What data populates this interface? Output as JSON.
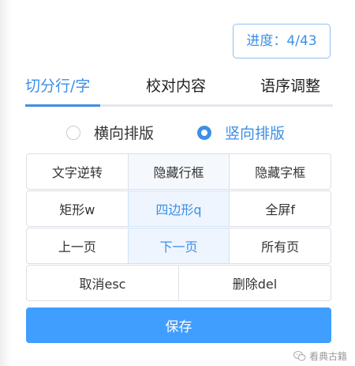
{
  "progress": {
    "label": "进度：4/43"
  },
  "tabs": [
    {
      "label": "切分行/字",
      "active": true
    },
    {
      "label": "校对内容",
      "active": false
    },
    {
      "label": "语序调整",
      "active": false
    }
  ],
  "layout_mode": {
    "options": [
      {
        "label": "横向排版",
        "checked": false
      },
      {
        "label": "竖向排版",
        "checked": true
      }
    ]
  },
  "buttons": {
    "row1": [
      "文字逆转",
      "隐藏行框",
      "隐藏字框"
    ],
    "row2": [
      "矩形w",
      "四边形q",
      "全屏f"
    ],
    "row3": [
      "上一页",
      "下一页",
      "所有页"
    ],
    "row4": [
      "取消esc",
      "删除del"
    ]
  },
  "save_label": "保存",
  "watermark": {
    "text": "看典古籍",
    "icon": "wechat-icon"
  },
  "colors": {
    "accent": "#409eff",
    "accent_text": "#3d8fe6",
    "highlight_bg": "#eef5fe"
  }
}
